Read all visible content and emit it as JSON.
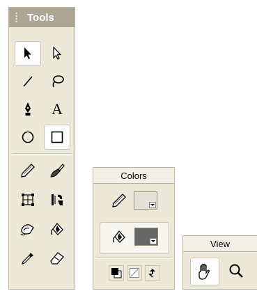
{
  "tools_panel": {
    "title": "Tools",
    "tools": [
      {
        "icon": "arrow-icon",
        "name": "selection-tool",
        "selected": true
      },
      {
        "icon": "subselect-arrow-icon",
        "name": "subselection-tool"
      },
      {
        "icon": "line-icon",
        "name": "line-tool"
      },
      {
        "icon": "lasso-icon",
        "name": "lasso-tool"
      },
      {
        "icon": "pen-icon",
        "name": "pen-tool"
      },
      {
        "icon": "text-icon",
        "name": "text-tool",
        "glyph": "A"
      },
      {
        "icon": "oval-icon",
        "name": "oval-tool"
      },
      {
        "icon": "rectangle-icon",
        "name": "rectangle-tool",
        "selected": true
      },
      {
        "icon": "pencil-icon",
        "name": "pencil-tool"
      },
      {
        "icon": "brush-icon",
        "name": "brush-tool"
      },
      {
        "icon": "free-transform-icon",
        "name": "free-transform-tool"
      },
      {
        "icon": "fill-transform-icon",
        "name": "fill-transform-tool"
      },
      {
        "icon": "ink-bottle-icon",
        "name": "ink-bottle-tool"
      },
      {
        "icon": "paint-bucket-icon",
        "name": "paint-bucket-tool"
      },
      {
        "icon": "eyedropper-icon",
        "name": "eyedropper-tool"
      },
      {
        "icon": "eraser-icon",
        "name": "eraser-tool"
      }
    ]
  },
  "colors_panel": {
    "title": "Colors",
    "stroke_color": "#e4e1d6",
    "fill_color": "#666666"
  },
  "view_panel": {
    "title": "View"
  }
}
